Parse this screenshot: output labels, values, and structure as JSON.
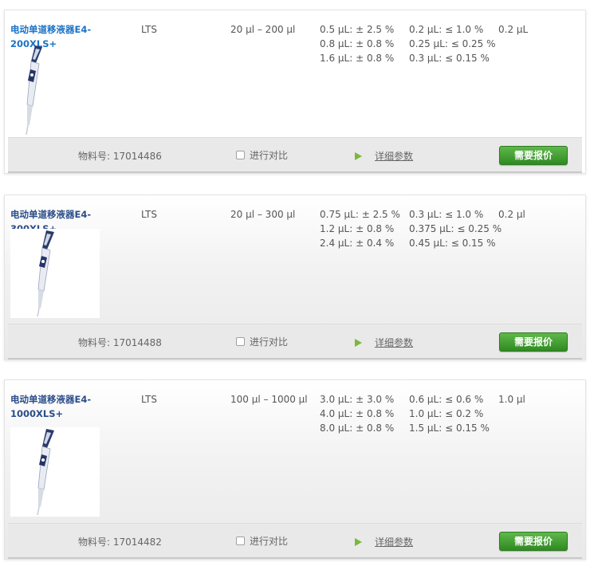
{
  "colors": {
    "link_first": "#1a73c6",
    "link": "#2a4d8a",
    "button_top": "#5fb84a",
    "button_bottom": "#2f8a22"
  },
  "products": [
    {
      "name": "电动单道移液器E4-200XLS+",
      "series": "LTS",
      "volume_range": "20 µl – 200 µl",
      "accuracy": [
        "0.5 µL: ± 2.5 %",
        "0.8 µL: ± 0.8 %",
        "1.6 µL: ± 0.8 %"
      ],
      "precision": [
        "0.2 µL: ≤ 1.0 %",
        "0.25 µL: ≤ 0.25 %",
        "0.3 µL: ≤ 0.15 %"
      ],
      "increment": "0.2 µL",
      "part_number": "物料号: 17014486",
      "compare_label": "进行对比",
      "details_label": "详细参数",
      "quote_label": "需要报价",
      "image_icon": "pipette-icon"
    },
    {
      "name": "电动单道移液器E4-300XLS+",
      "series": "LTS",
      "volume_range": "20 µl – 300 µl",
      "accuracy": [
        "0.75 µL: ± 2.5 %",
        "1.2 µL: ± 0.8 %",
        "2.4 µL: ± 0.4 %"
      ],
      "precision": [
        "0.3 µL: ≤ 1.0 %",
        "0.375 µL: ≤ 0.25 %",
        "0.45 µL: ≤ 0.15 %"
      ],
      "increment": "0.2 µl",
      "part_number": "物料号: 17014488",
      "compare_label": "进行对比",
      "details_label": "详细参数",
      "quote_label": "需要报价",
      "image_icon": "pipette-icon"
    },
    {
      "name": "电动单道移液器E4-1000XLS+",
      "series": "LTS",
      "volume_range": "100 µl – 1000 µl",
      "accuracy": [
        "3.0 µL: ± 3.0 %",
        "4.0 µL: ± 0.8 %",
        "8.0 µL: ± 0.8 %"
      ],
      "precision": [
        "0.6 µL: ≤ 0.6 %",
        "1.0 µL: ≤ 0.2 %",
        "1.5 µL: ≤ 0.15 %"
      ],
      "increment": "1.0 µl",
      "part_number": "物料号: 17014482",
      "compare_label": "进行对比",
      "details_label": "详细参数",
      "quote_label": "需要报价",
      "image_icon": "pipette-icon"
    }
  ]
}
